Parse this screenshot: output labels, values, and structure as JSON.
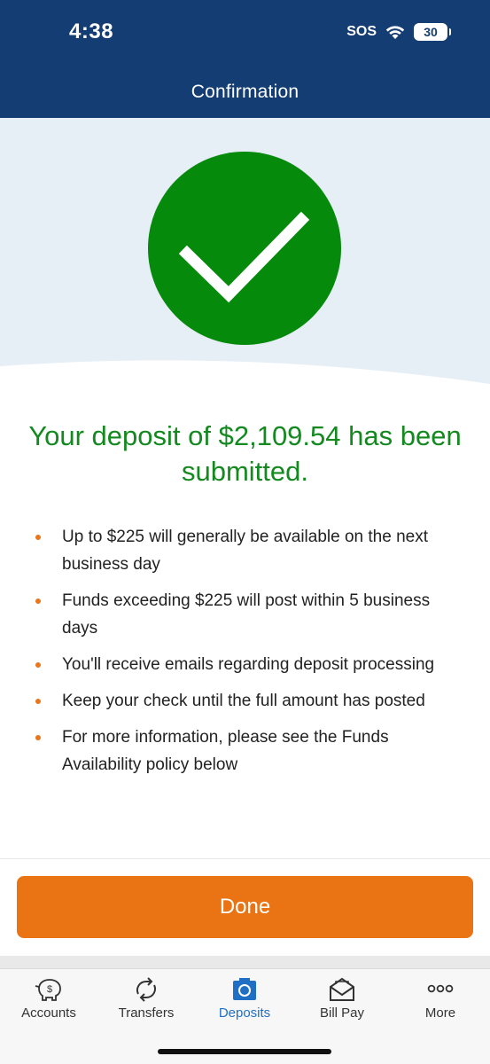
{
  "status_bar": {
    "time": "4:38",
    "sos": "SOS",
    "battery": "30"
  },
  "header": {
    "title": "Confirmation"
  },
  "hero": {
    "icon": "checkmark-icon",
    "circle_color": "#058a0b",
    "band_color": "#e6eef6"
  },
  "message": {
    "text": "Your deposit of $2,109.54 has been submitted."
  },
  "bullets": [
    "Up to $225 will generally be available on the next business day",
    "Funds exceeding $225 will post within 5 business days",
    "You'll receive emails regarding deposit processing",
    "Keep your check until the full amount has posted",
    "For more information, please see the Funds Availability policy below"
  ],
  "actions": {
    "done_label": "Done"
  },
  "tabs": [
    {
      "label": "Accounts",
      "icon": "piggy-bank-icon",
      "active": false
    },
    {
      "label": "Transfers",
      "icon": "transfer-arrows-icon",
      "active": false
    },
    {
      "label": "Deposits",
      "icon": "camera-icon",
      "active": true
    },
    {
      "label": "Bill Pay",
      "icon": "envelope-icon",
      "active": false
    },
    {
      "label": "More",
      "icon": "more-dots-icon",
      "active": false
    }
  ],
  "colors": {
    "header": "#143d73",
    "accent_orange": "#ea7413",
    "success_green": "#13891f",
    "active_tab": "#1f6fc4"
  }
}
